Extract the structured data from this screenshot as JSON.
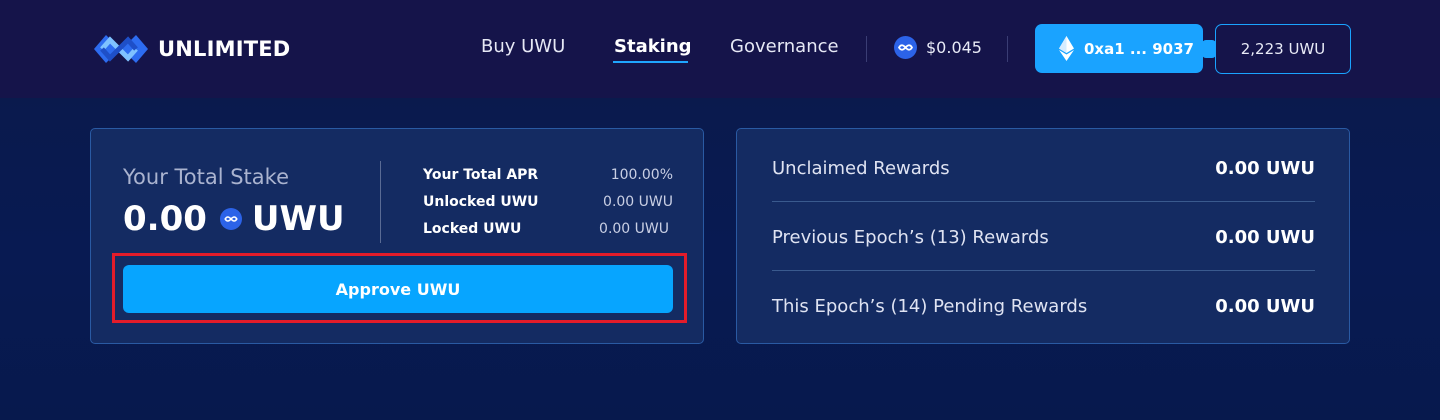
{
  "brand": {
    "name": "UNLIMITED",
    "logo_icon": "infinity-logo-icon"
  },
  "nav": {
    "links": [
      {
        "label": "Buy UWU",
        "active": false
      },
      {
        "label": "Staking",
        "active": true
      },
      {
        "label": "Governance",
        "active": false
      }
    ]
  },
  "price": {
    "icon": "uwu-coin-icon",
    "value": "$0.045"
  },
  "wallet": {
    "icon": "ethereum-icon",
    "address": "0xa1 ... 9037",
    "balance": "2,223 UWU"
  },
  "stake": {
    "label": "Your Total Stake",
    "amount": "0.00",
    "unit": "UWU",
    "stats": [
      {
        "label": "Your Total APR",
        "value": "100.00%"
      },
      {
        "label": "Unlocked UWU",
        "value": "0.00 UWU"
      },
      {
        "label": "Locked UWU",
        "value": "0.00 UWU"
      }
    ],
    "approve_label": "Approve UWU"
  },
  "rewards": [
    {
      "label": "Unclaimed Rewards",
      "value": "0.00 UWU"
    },
    {
      "label": "Previous Epoch’s (13) Rewards",
      "value": "0.00 UWU"
    },
    {
      "label": "This Epoch’s (14) Pending Rewards",
      "value": "0.00 UWU"
    }
  ],
  "colors": {
    "accent": "#1aa3ff",
    "highlight": "#e31c2a",
    "coin": "#2c63e8"
  }
}
